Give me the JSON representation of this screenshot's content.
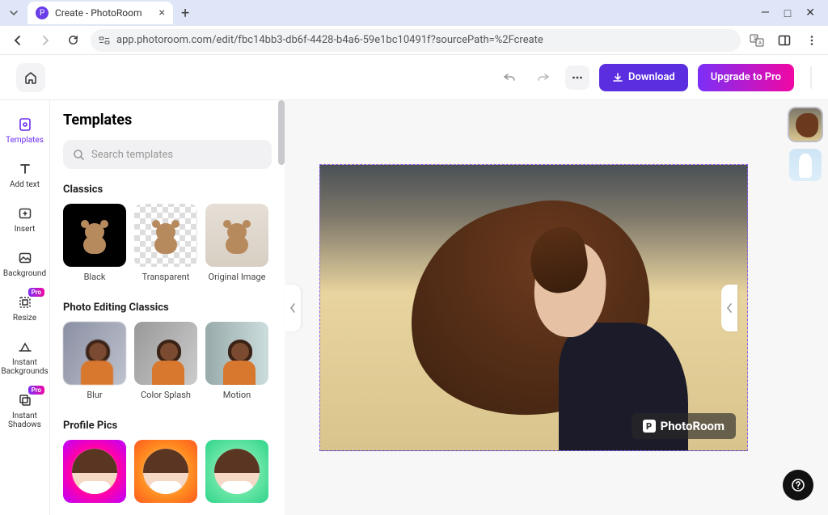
{
  "browser": {
    "tab_title": "Create - PhotoRoom",
    "url": "app.photoroom.com/edit/fbc14bb3-db6f-4428-b4a6-59e1bc10491f?sourcePath=%2Fcreate"
  },
  "topbar": {
    "download_label": "Download",
    "upgrade_label": "Upgrade to Pro"
  },
  "sidebar": {
    "items": [
      {
        "label": "Templates",
        "pro": false
      },
      {
        "label": "Add text",
        "pro": false
      },
      {
        "label": "Insert",
        "pro": false
      },
      {
        "label": "Background",
        "pro": false
      },
      {
        "label": "Resize",
        "pro": true
      },
      {
        "label": "Instant Backgrounds",
        "pro": false
      },
      {
        "label": "Instant Shadows",
        "pro": true
      }
    ],
    "pro_badge": "Pro"
  },
  "panel": {
    "title": "Templates",
    "search_placeholder": "Search templates",
    "sections": [
      {
        "title": "Classics",
        "items": [
          "Black",
          "Transparent",
          "Original Image"
        ]
      },
      {
        "title": "Photo Editing Classics",
        "items": [
          "Blur",
          "Color Splash",
          "Motion"
        ]
      },
      {
        "title": "Profile Pics",
        "items": [
          "",
          "",
          ""
        ]
      }
    ]
  },
  "canvas": {
    "watermark": "PhotoRoom"
  }
}
